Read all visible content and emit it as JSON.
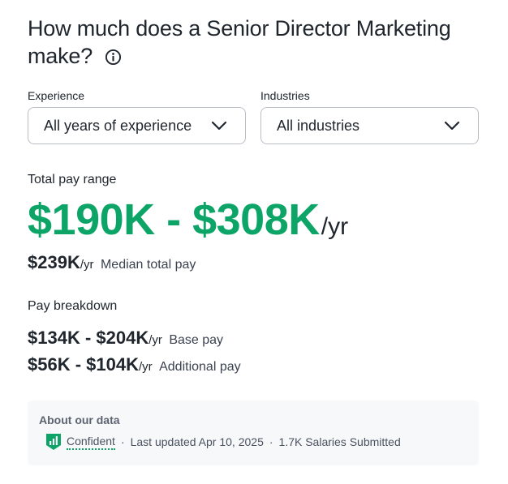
{
  "header": {
    "title": "How much does a Senior Director Marketing make?",
    "info_icon": "info-icon"
  },
  "filters": {
    "experience": {
      "label": "Experience",
      "value": "All years of experience"
    },
    "industries": {
      "label": "Industries",
      "value": "All industries"
    }
  },
  "pay": {
    "range_label": "Total pay range",
    "range": "$190K - $308K",
    "range_unit": "/yr",
    "median_amount": "$239K",
    "median_unit": "/yr",
    "median_desc": "Median total pay"
  },
  "breakdown": {
    "label": "Pay breakdown",
    "base": {
      "amount": "$134K - $204K",
      "unit": "/yr",
      "desc": "Base pay"
    },
    "additional": {
      "amount": "$56K - $104K",
      "unit": "/yr",
      "desc": "Additional pay"
    }
  },
  "about": {
    "title": "About our data",
    "confidence": "Confident",
    "confidence_icon": "bar-chart-shield-icon",
    "separator": "·",
    "last_updated": "Last updated Apr 10, 2025",
    "salaries": "1.7K Salaries Submitted"
  },
  "colors": {
    "accent_green": "#0ca567",
    "text": "#20262e",
    "panel_bg": "#f6f8fa"
  }
}
